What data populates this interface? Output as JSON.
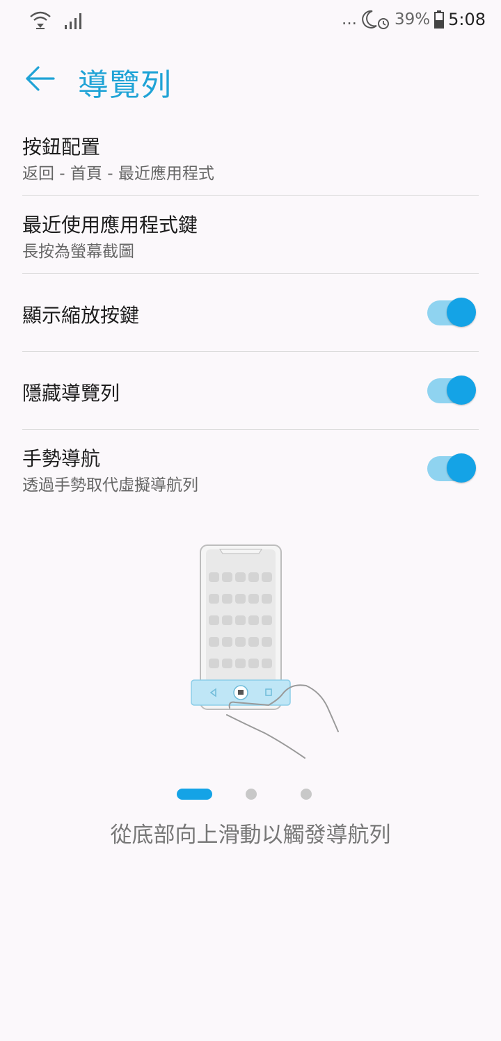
{
  "status_bar": {
    "more_indicator": "...",
    "battery_percent": "39%",
    "time": "5:08",
    "icons": [
      "wifi-icon",
      "signal-icon",
      "moon-icon",
      "alarm-icon",
      "battery-icon"
    ]
  },
  "header": {
    "title": "導覽列",
    "back_icon": "back-arrow-icon",
    "accent_color": "#1fa3d6"
  },
  "settings": {
    "items": [
      {
        "title": "按鈕配置",
        "subtitle": "返回 - 首頁 - 最近應用程式"
      },
      {
        "title": "最近使用應用程式鍵",
        "subtitle": "長按為螢幕截圖"
      },
      {
        "title": "顯示縮放按鍵",
        "toggle": true
      },
      {
        "title": "隱藏導覽列",
        "toggle": true
      },
      {
        "title": "手勢導航",
        "subtitle": "透過手勢取代虛擬導航列",
        "toggle": true
      }
    ],
    "toggle_on_color": "#14a3e6"
  },
  "tutorial": {
    "illustration": "phone-gesture-illustration",
    "page_count": 3,
    "active_page": 1,
    "caption": "從底部向上滑動以觸發導航列"
  }
}
